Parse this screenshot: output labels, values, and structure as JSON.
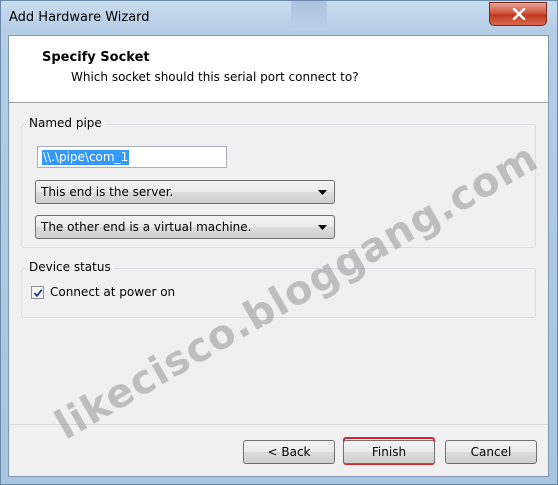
{
  "window": {
    "title": "Add Hardware Wizard"
  },
  "header": {
    "title": "Specify Socket",
    "subtitle": "Which socket should this serial port connect to?"
  },
  "named_pipe": {
    "group_label": "Named pipe",
    "pipe_value": "\\\\.\\pipe\\com_1",
    "end_select_value": "This end is the server.",
    "other_end_select_value": "The other end is a virtual machine."
  },
  "device_status": {
    "group_label": "Device status",
    "connect_label": "Connect at power on",
    "connect_checked": true
  },
  "buttons": {
    "back": "< Back",
    "finish": "Finish",
    "cancel": "Cancel"
  },
  "watermark": "likecisco.bloggang.com",
  "colors": {
    "highlight_outline": "#d9262e",
    "selection": "#3399ff",
    "close_button": "#c03a20"
  }
}
